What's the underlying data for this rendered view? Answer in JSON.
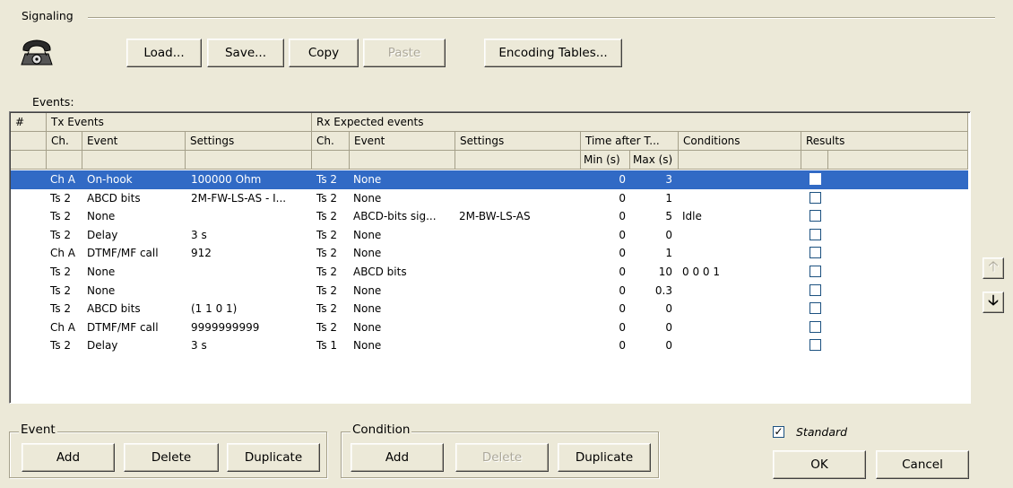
{
  "section": {
    "title": "Signaling"
  },
  "toolbar": {
    "load": "Load...",
    "save": "Save...",
    "copy": "Copy",
    "paste": "Paste",
    "encoding_tables": "Encoding Tables..."
  },
  "events_label": "Events:",
  "grid": {
    "group_headers": {
      "num": "#",
      "tx": "Tx Events",
      "rx": "Rx Expected events"
    },
    "columns": {
      "tx_ch": "Ch.",
      "tx_event": "Event",
      "tx_settings": "Settings",
      "rx_ch": "Ch.",
      "rx_event": "Event",
      "rx_settings": "Settings",
      "time_after": "Time after T...",
      "conditions": "Conditions",
      "results": "Results",
      "min": "Min (s)",
      "max": "Max (s)"
    },
    "rows": [
      {
        "tx_ch": "Ch A",
        "tx_event": "On-hook",
        "tx_settings": "100000 Ohm",
        "rx_ch": "Ts 2",
        "rx_event": "None",
        "rx_settings": "",
        "min": "0",
        "max": "3",
        "conditions": "",
        "selected": true
      },
      {
        "tx_ch": "Ts 2",
        "tx_event": "ABCD bits",
        "tx_settings": "2M-FW-LS-AS - I...",
        "rx_ch": "Ts 2",
        "rx_event": "None",
        "rx_settings": "",
        "min": "0",
        "max": "1",
        "conditions": ""
      },
      {
        "tx_ch": "Ts 2",
        "tx_event": "None",
        "tx_settings": "",
        "rx_ch": "Ts 2",
        "rx_event": "ABCD-bits sig...",
        "rx_settings": "2M-BW-LS-AS",
        "min": "0",
        "max": "5",
        "conditions": "Idle"
      },
      {
        "tx_ch": "Ts 2",
        "tx_event": "Delay",
        "tx_settings": "3 s",
        "rx_ch": "Ts 2",
        "rx_event": "None",
        "rx_settings": "",
        "min": "0",
        "max": "0",
        "conditions": ""
      },
      {
        "tx_ch": "Ch A",
        "tx_event": "DTMF/MF call",
        "tx_settings": "912",
        "rx_ch": "Ts 2",
        "rx_event": "None",
        "rx_settings": "",
        "min": "0",
        "max": "1",
        "conditions": ""
      },
      {
        "tx_ch": "Ts 2",
        "tx_event": "None",
        "tx_settings": "",
        "rx_ch": "Ts 2",
        "rx_event": "ABCD bits",
        "rx_settings": "",
        "min": "0",
        "max": "10",
        "conditions": "0 0 0 1"
      },
      {
        "tx_ch": "Ts 2",
        "tx_event": "None",
        "tx_settings": "",
        "rx_ch": "Ts 2",
        "rx_event": "None",
        "rx_settings": "",
        "min": "0",
        "max": "0.3",
        "conditions": ""
      },
      {
        "tx_ch": "Ts 2",
        "tx_event": "ABCD bits",
        "tx_settings": " (1 1 0 1)",
        "rx_ch": "Ts 2",
        "rx_event": "None",
        "rx_settings": "",
        "min": "0",
        "max": "0",
        "conditions": ""
      },
      {
        "tx_ch": "Ch A",
        "tx_event": "DTMF/MF call",
        "tx_settings": "9999999999",
        "rx_ch": "Ts 2",
        "rx_event": "None",
        "rx_settings": "",
        "min": "0",
        "max": "0",
        "conditions": ""
      },
      {
        "tx_ch": "Ts 2",
        "tx_event": "Delay",
        "tx_settings": "3 s",
        "rx_ch": "Ts 1",
        "rx_event": "None",
        "rx_settings": "",
        "min": "0",
        "max": "0",
        "conditions": ""
      }
    ]
  },
  "event_group": {
    "title": "Event",
    "add": "Add",
    "delete": "Delete",
    "duplicate": "Duplicate"
  },
  "condition_group": {
    "title": "Condition",
    "add": "Add",
    "delete": "Delete",
    "duplicate": "Duplicate"
  },
  "standard": {
    "label": "Standard",
    "checked": true,
    "mark": "✓"
  },
  "dialog": {
    "ok": "OK",
    "cancel": "Cancel"
  },
  "icons": {
    "phone": "telephone-icon",
    "move_up": "arrow-up-icon",
    "move_down": "arrow-down-icon"
  }
}
